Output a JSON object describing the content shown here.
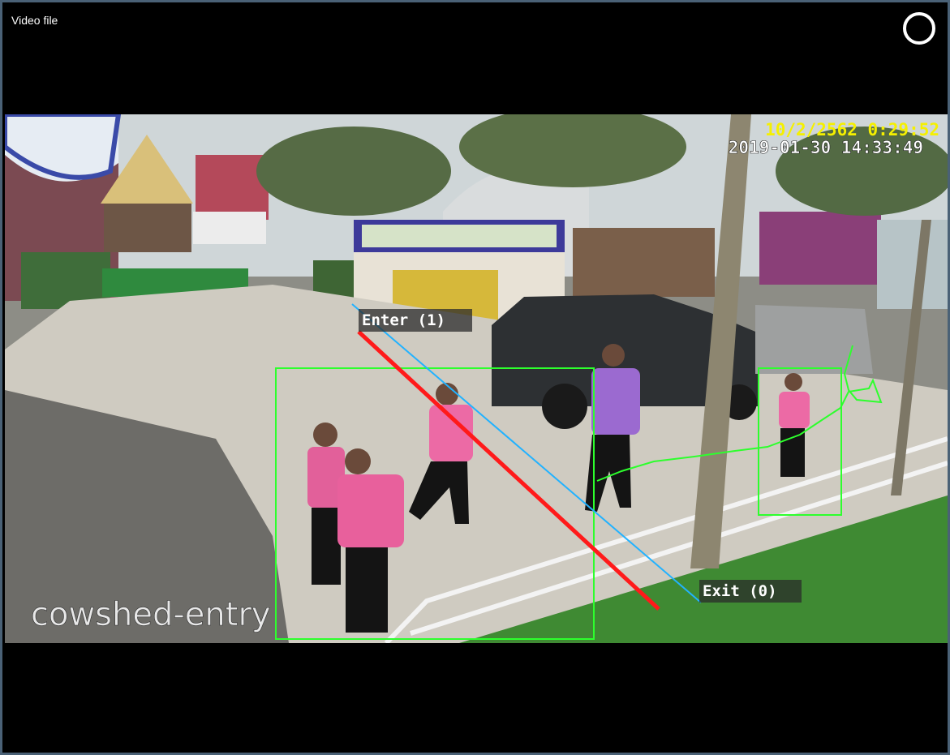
{
  "window": {
    "title": "Video file",
    "spinner_icon": "loading-spinner-icon"
  },
  "video": {
    "timestamp_primary": "10/2/2562 0:29:52",
    "timestamp_secondary": "2019-01-30 14:33:49",
    "camera_name": "cowshed-entry",
    "enter_label": "Enter (1)",
    "exit_label": "Exit (0)",
    "colors": {
      "timestamp_primary": "#f5f000",
      "timestamp_secondary": "#ffffff",
      "enter_line": "#ff1a1a",
      "exit_line": "#22b2ff",
      "bounding_box": "#2dff2d",
      "track": "#2dff2d"
    }
  }
}
